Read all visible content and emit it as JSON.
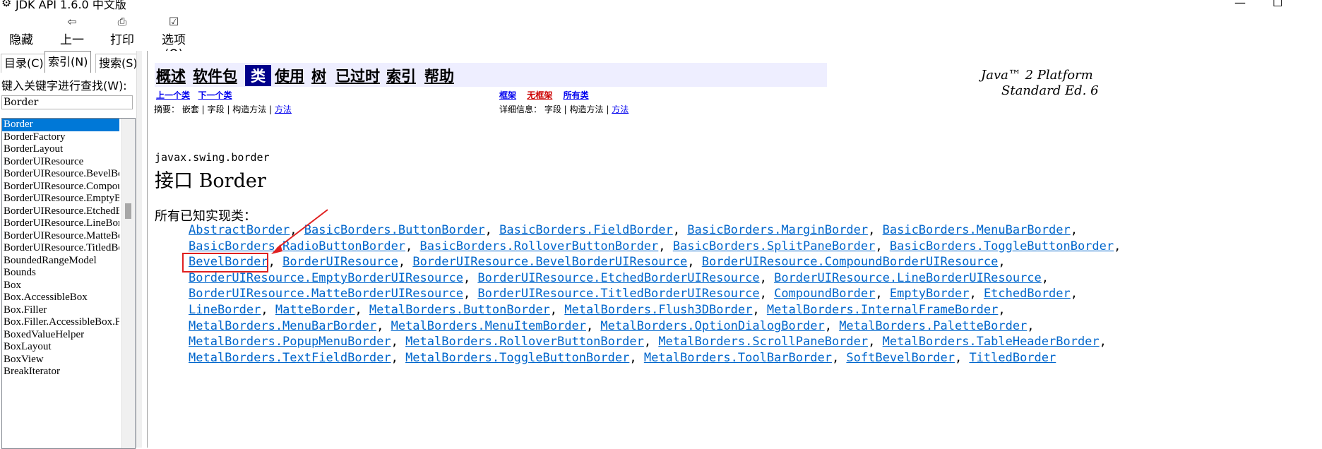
{
  "window": {
    "title": "JDK API 1.6.0 中文版",
    "controls": [
      "—",
      "☐"
    ]
  },
  "toolbar": {
    "buttons": [
      {
        "label": "隐藏",
        "icon": "hide-icon"
      },
      {
        "label": "上一步",
        "icon": "back-icon"
      },
      {
        "label": "打印",
        "icon": "print-icon"
      },
      {
        "label": "选项(O)",
        "icon": "options-icon"
      }
    ]
  },
  "left": {
    "tabs": [
      "目录(C)",
      "索引(N)",
      "搜索(S)"
    ],
    "active_tab": "索引(N)",
    "search_label": "键入关键字进行查找(W):",
    "search_value": "Border",
    "index_items": [
      "Border",
      "BorderFactory",
      "BorderLayout",
      "BorderUIResource",
      "BorderUIResource.BevelBorderUIResource",
      "BorderUIResource.CompoundBorderUIResource",
      "BorderUIResource.EmptyBorderUIResource",
      "BorderUIResource.EtchedBorderUIResource",
      "BorderUIResource.LineBorderUIResource",
      "BorderUIResource.MatteBorderUIResource",
      "BorderUIResource.TitledBorderUIResource",
      "BoundedRangeModel",
      "Bounds",
      "Box",
      "Box.AccessibleBox",
      "Box.Filler",
      "Box.Filler.AccessibleBox.Filler",
      "BoxedValueHelper",
      "BoxLayout",
      "BoxView",
      "BreakIterator"
    ],
    "selected_index": 0
  },
  "content": {
    "nav": {
      "overview": "概述",
      "package": "软件包",
      "class": "类",
      "use": "使用",
      "tree": "树",
      "deprecated": "已过时",
      "index": "索引",
      "help": "帮助"
    },
    "platform_line1": "Java™ 2 Platform",
    "platform_line2": "Standard Ed. 6",
    "prev_class": "上一个类",
    "next_class": "下一个类",
    "frames": "框架",
    "no_frames": "无框架",
    "all_classes": "所有类",
    "summary_label": "摘要：",
    "summary_items": "嵌套 | 字段 | 构造方法 | ",
    "summary_method": "方法",
    "detail_label": "详细信息：",
    "detail_items": "字段 | 构造方法 | ",
    "detail_method": "方法",
    "package_name": "javax.swing.border",
    "title": "接口 Border",
    "known_impl_label": "所有已知实现类：",
    "impl_lines": [
      [
        "AbstractBorder",
        "BasicBorders.ButtonBorder",
        "BasicBorders.FieldBorder",
        "BasicBorders.MarginBorder",
        "BasicBorders.MenuBarBorder"
      ],
      [
        "BasicBorders.RadioButtonBorder",
        "BasicBorders.RolloverButtonBorder",
        "BasicBorders.SplitPaneBorder",
        "BasicBorders.ToggleButtonBorder"
      ],
      [
        "BevelBorder",
        "BorderUIResource",
        "BorderUIResource.BevelBorderUIResource",
        "BorderUIResource.CompoundBorderUIResource"
      ],
      [
        "BorderUIResource.EmptyBorderUIResource",
        "BorderUIResource.EtchedBorderUIResource",
        "BorderUIResource.LineBorderUIResource"
      ],
      [
        "BorderUIResource.MatteBorderUIResource",
        "BorderUIResource.TitledBorderUIResource",
        "CompoundBorder",
        "EmptyBorder",
        "EtchedBorder"
      ],
      [
        "LineBorder",
        "MatteBorder",
        "MetalBorders.ButtonBorder",
        "MetalBorders.Flush3DBorder",
        "MetalBorders.InternalFrameBorder"
      ],
      [
        "MetalBorders.MenuBarBorder",
        "MetalBorders.MenuItemBorder",
        "MetalBorders.OptionDialogBorder",
        "MetalBorders.PaletteBorder"
      ],
      [
        "MetalBorders.PopupMenuBorder",
        "MetalBorders.RolloverButtonBorder",
        "MetalBorders.ScrollPaneBorder",
        "MetalBorders.TableHeaderBorder"
      ],
      [
        "MetalBorders.TextFieldBorder",
        "MetalBorders.ToggleButtonBorder",
        "MetalBorders.ToolBarBorder",
        "SoftBevelBorder",
        "TitledBorder"
      ]
    ],
    "line_end_punct": [
      ",",
      ",",
      ",",
      ",",
      ",",
      ",",
      ",",
      ",",
      ""
    ]
  },
  "colors": {
    "link": "#0066cc",
    "nav_bg": "#eeeeff",
    "nav_current_bg": "#00008b",
    "selection": "#0078d7",
    "annotation": "#e02020"
  }
}
